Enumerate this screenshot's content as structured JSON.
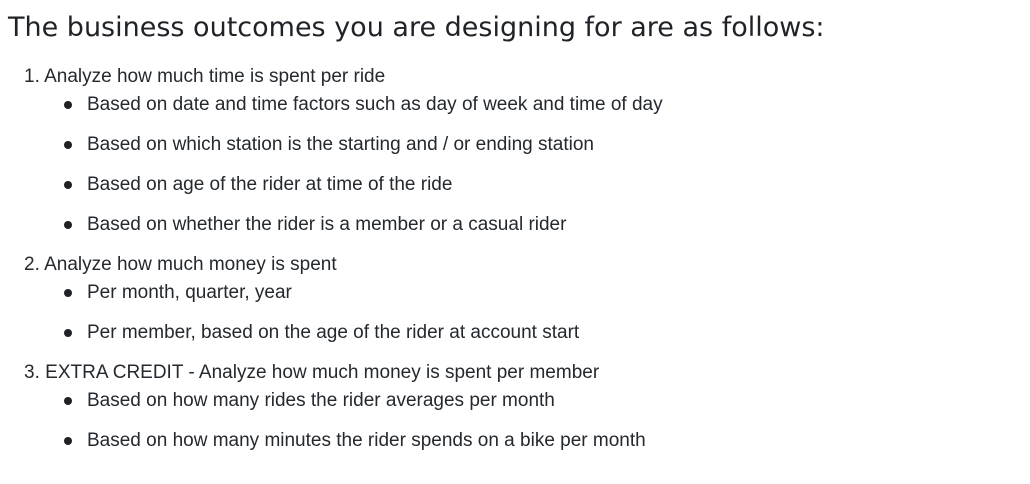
{
  "heading": "The business outcomes you are designing for are as follows:",
  "outcomes": [
    {
      "number": "1.",
      "text": "Analyze how much time is spent per ride",
      "items": [
        "Based on date and time factors such as day of week and time of day",
        "Based on which station is the starting and / or ending station",
        "Based on age of the rider at time of the ride",
        "Based on whether the rider is a member or a casual rider"
      ]
    },
    {
      "number": "2.",
      "text": "Analyze how much money is spent",
      "items": [
        "Per month, quarter, year",
        "Per member, based on the age of the rider at account start"
      ]
    },
    {
      "number": "3.",
      "text": "EXTRA CREDIT - Analyze how much money is spent per member",
      "items": [
        "Based on how many rides the rider averages per month",
        "Based on how many minutes the rider spends on a bike per month"
      ]
    }
  ]
}
